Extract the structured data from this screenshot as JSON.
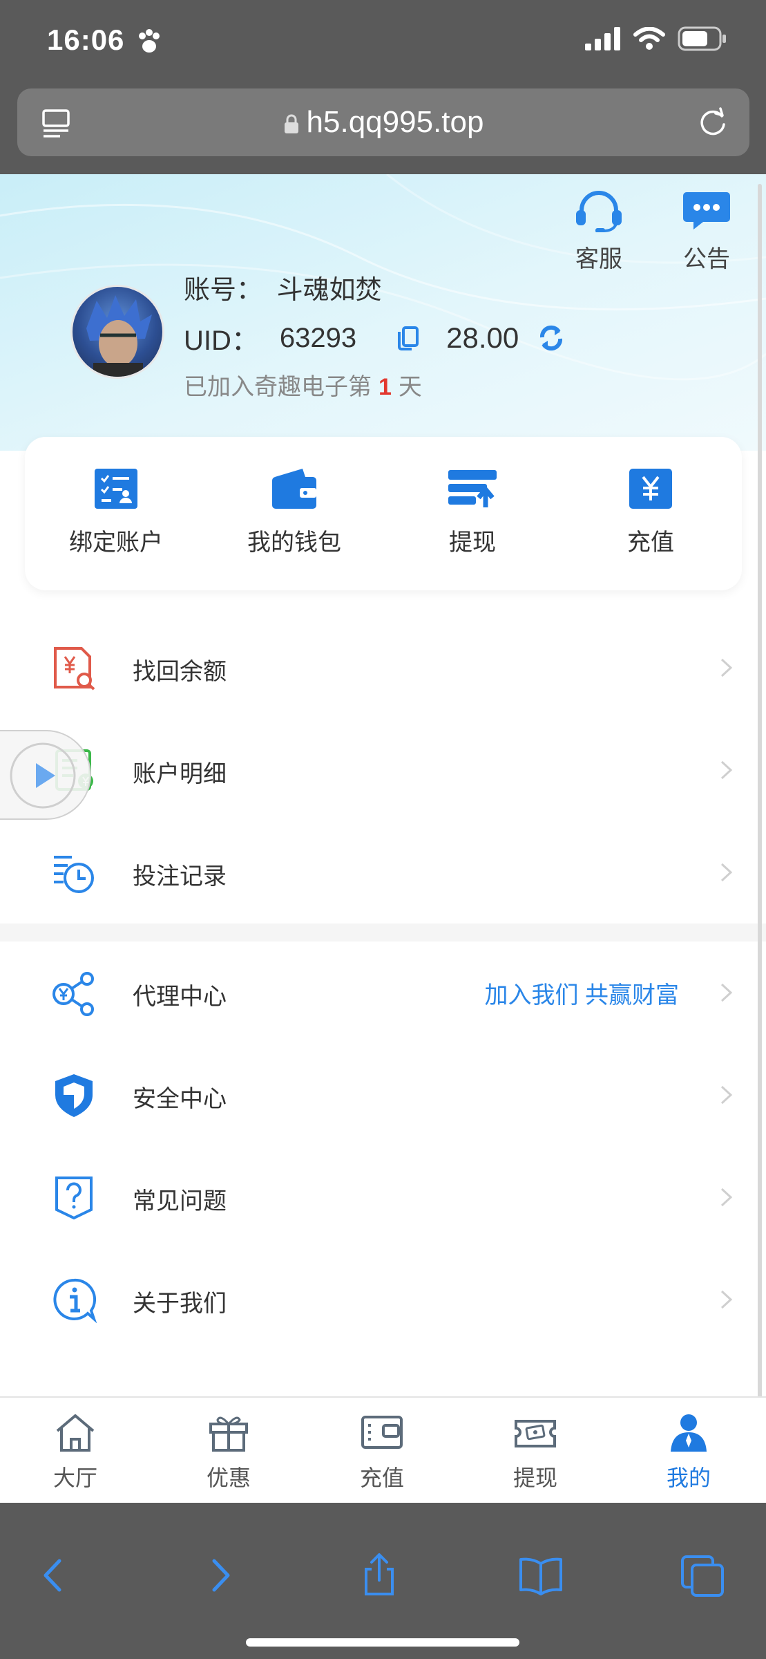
{
  "status_bar": {
    "time": "16:06"
  },
  "browser": {
    "url": "h5.qq995.top"
  },
  "header": {
    "customer_service_label": "客服",
    "notice_label": "公告"
  },
  "profile": {
    "account_label": "账号：",
    "account_name": "斗魂如焚",
    "uid_label": "UID：",
    "uid": "63293",
    "balance": "28.00",
    "joined_prefix": "已加入奇趣电子第",
    "joined_days": "1",
    "joined_suffix": "天"
  },
  "quick_actions": [
    {
      "label": "绑定账户",
      "icon": "bind-account-icon"
    },
    {
      "label": "我的钱包",
      "icon": "wallet-icon"
    },
    {
      "label": "提现",
      "icon": "withdraw-icon"
    },
    {
      "label": "充值",
      "icon": "recharge-icon"
    }
  ],
  "menu_group1": [
    {
      "label": "找回余额",
      "icon": "recover-balance-icon"
    },
    {
      "label": "账户明细",
      "icon": "account-details-icon"
    },
    {
      "label": "投注记录",
      "icon": "bet-record-icon"
    }
  ],
  "menu_group2": [
    {
      "label": "代理中心",
      "icon": "agent-center-icon",
      "extra": "加入我们 共赢财富"
    },
    {
      "label": "安全中心",
      "icon": "security-shield-icon"
    },
    {
      "label": "常见问题",
      "icon": "faq-icon"
    },
    {
      "label": "关于我们",
      "icon": "about-info-icon"
    }
  ],
  "tabbar": [
    {
      "label": "大厅",
      "icon": "home-icon",
      "active": false
    },
    {
      "label": "优惠",
      "icon": "gift-icon",
      "active": false
    },
    {
      "label": "充值",
      "icon": "recharge-card-icon",
      "active": false
    },
    {
      "label": "提现",
      "icon": "withdraw-cash-icon",
      "active": false
    },
    {
      "label": "我的",
      "icon": "user-icon",
      "active": true
    }
  ],
  "colors": {
    "accent": "#1f7ae0",
    "hero_bg": "#d4f1f9",
    "days_highlight": "#e2382f",
    "browser_chrome": "#5a5a5a"
  }
}
